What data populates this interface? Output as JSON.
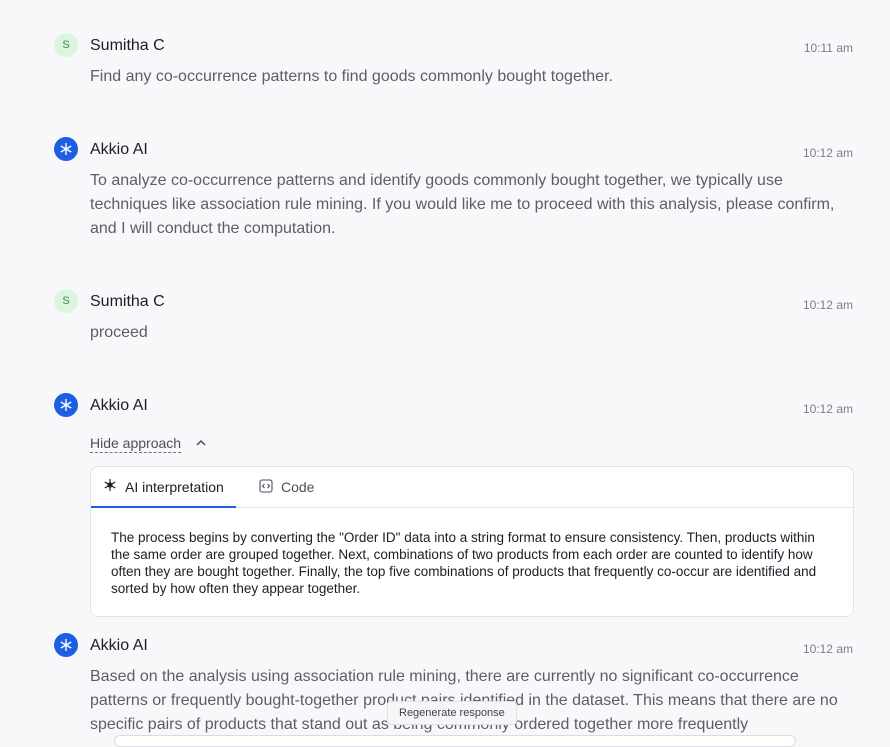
{
  "messages": [
    {
      "name": "Sumitha C",
      "avatar": "S",
      "time": "10:11 am",
      "text": "Find any co-occurrence patterns to find goods commonly bought together."
    },
    {
      "name": "Akkio AI",
      "time": "10:12 am",
      "text": "To analyze co-occurrence patterns and identify goods commonly bought together, we typically use techniques like association rule mining. If you would like me to proceed with this analysis, please confirm, and I will conduct the computation."
    },
    {
      "name": "Sumitha C",
      "avatar": "S",
      "time": "10:12 am",
      "text": "proceed"
    },
    {
      "name": "Akkio AI",
      "time": "10:12 am",
      "hide_approach": "Hide approach",
      "tabs": {
        "interpretation": "AI interpretation",
        "code": "Code"
      },
      "interpretation": "The process begins by converting the \"Order ID\" data into a string format to ensure consistency. Then, products within the same order are grouped together. Next, combinations of two products from each order are counted to identify how often they are bought together. Finally, the top five combinations of products that frequently co-occur are identified and sorted by how often they appear together."
    },
    {
      "name": "Akkio AI",
      "time": "10:12 am",
      "text": "Based on the analysis using association rule mining, there are currently no significant co-occurrence patterns or frequently bought-together product pairs identified in the dataset. This means that there are no specific pairs of products that stand out as being commonly ordered together more frequently"
    }
  ],
  "regenerate_label": "Regenerate response",
  "icons": {
    "ai_avatar": "snowflake-icon",
    "chevron": "chevron-up-icon",
    "interpretation_tab": "sparkle-icon",
    "code_tab": "code-icon"
  },
  "colors": {
    "accent": "#1d5fe0",
    "user_avatar_bg": "#dcf5df",
    "user_avatar_fg": "#3e8a4b"
  }
}
